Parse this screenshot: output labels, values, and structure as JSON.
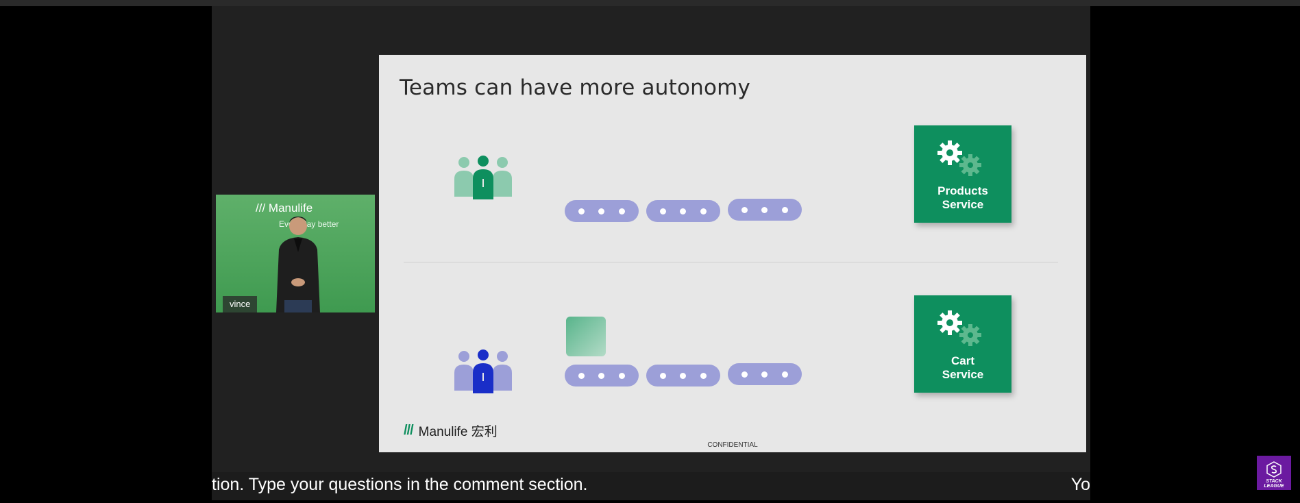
{
  "slide": {
    "title": "Teams can have more autonomy",
    "services": [
      {
        "line1": "Products",
        "line2": "Service"
      },
      {
        "line1": "Cart",
        "line2": "Service"
      }
    ],
    "logo_text": "Manulife 宏利",
    "footer": "CONFIDENTIAL",
    "colors": {
      "green": "#0e8f5e",
      "light_green": "#8ccaae",
      "blue": "#1a2ec8",
      "light_blue": "#9c9fd8"
    }
  },
  "camera": {
    "brand": "Manulife",
    "tagline": "Every day better",
    "participant_name": "vince"
  },
  "caption": {
    "text": "tion. Type your questions in the comment section.",
    "right_text": "Yo"
  },
  "badge": {
    "text": "STACK LEAGUE"
  }
}
